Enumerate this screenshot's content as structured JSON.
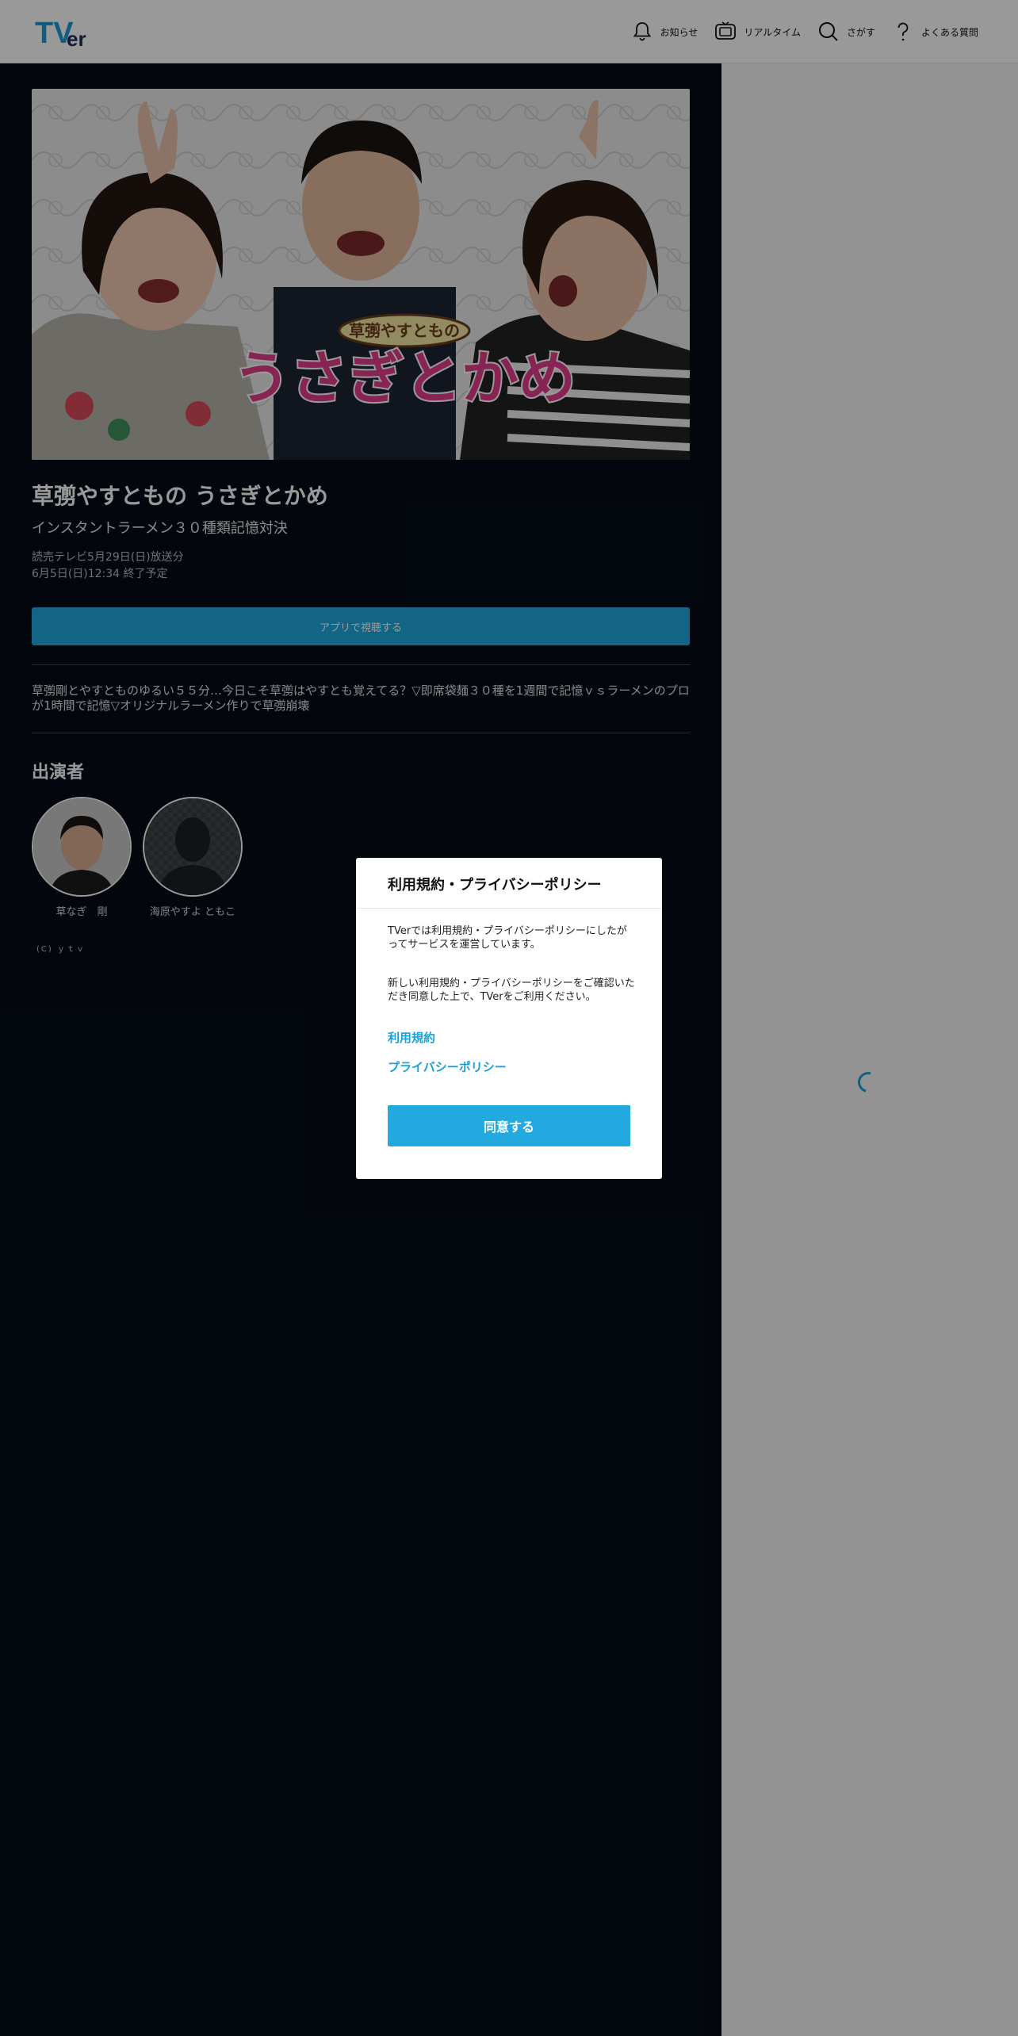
{
  "header": {
    "logo_text": "TVer",
    "nav": [
      {
        "label": "お知らせ",
        "icon": "bell-icon"
      },
      {
        "label": "リアルタイム",
        "icon": "tv-icon"
      },
      {
        "label": "さがす",
        "icon": "search-icon"
      },
      {
        "label": "よくある質問",
        "icon": "question-icon"
      }
    ]
  },
  "program": {
    "title": "草彅やすともの うさぎとかめ",
    "episode": "インスタントラーメン３０種類記憶対決",
    "broadcast": "読売テレビ5月29日(日)放送分",
    "expiry": "6月5日(日)12:34 終了予定",
    "watch_button": "アプリで視聴する",
    "description": "草彅剛とやすとものゆるい５５分…今日こそ草彅はやすとも覚えてる？▽即席袋麺３０種を1週間で記憶ｖｓラーメンのプロが1時間で記憶▽オリジナルラーメン作りで草彅崩壊",
    "hero_logo_top": "草彅やすともの",
    "hero_logo_main": "うさぎとかめ"
  },
  "cast": {
    "heading": "出演者",
    "members": [
      {
        "name": "草なぎ　剛"
      },
      {
        "name": "海原やすよ ともこ"
      }
    ]
  },
  "copyright": "(C) ｙｔｖ",
  "modal": {
    "title": "利用規約・プライバシーポリシー",
    "paragraph1": "TVerでは利用規約・プライバシーポリシーにしたがってサービスを運営しています。",
    "paragraph2": "新しい利用規約・プライバシーポリシーをご確認いただき同意した上で、TVerをご利用ください。",
    "link_terms": "利用規約",
    "link_privacy": "プライバシーポリシー",
    "agree_button": "同意する"
  },
  "colors": {
    "accent": "#21a9e0",
    "link": "#1aa1d8",
    "main_bg": "#050d17"
  }
}
